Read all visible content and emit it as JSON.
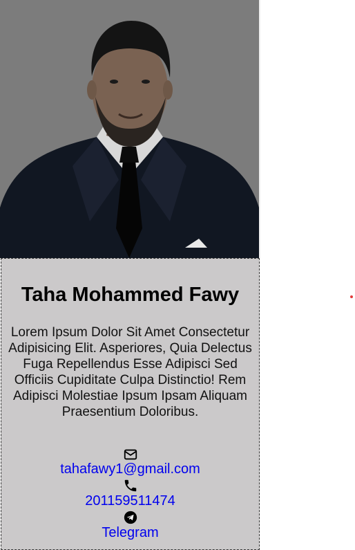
{
  "profile": {
    "name": "Taha Mohammed Fawy",
    "bio": "Lorem Ipsum Dolor Sit Amet Consectetur Adipisicing Elit. Asperiores, Quia Delectus Fuga Repellendus Esse Adipisci Sed Officiis Cupiditate Culpa Distinctio! Rem Adipisci Molestiae Ipsum Ipsam Aliquam Praesentium Doloribus.",
    "photo_icon": "person-photo"
  },
  "contacts": [
    {
      "icon": "envelope-icon",
      "text": "tahafawy1@gmail.com"
    },
    {
      "icon": "phone-icon",
      "text": "201159511474"
    },
    {
      "icon": "telegram-icon",
      "text": "Telegram"
    }
  ],
  "colors": {
    "photo_bg": "#7c7c7c",
    "card_bg": "#cbc9ca",
    "link": "#0000ee",
    "dot": "#e23a3a"
  }
}
